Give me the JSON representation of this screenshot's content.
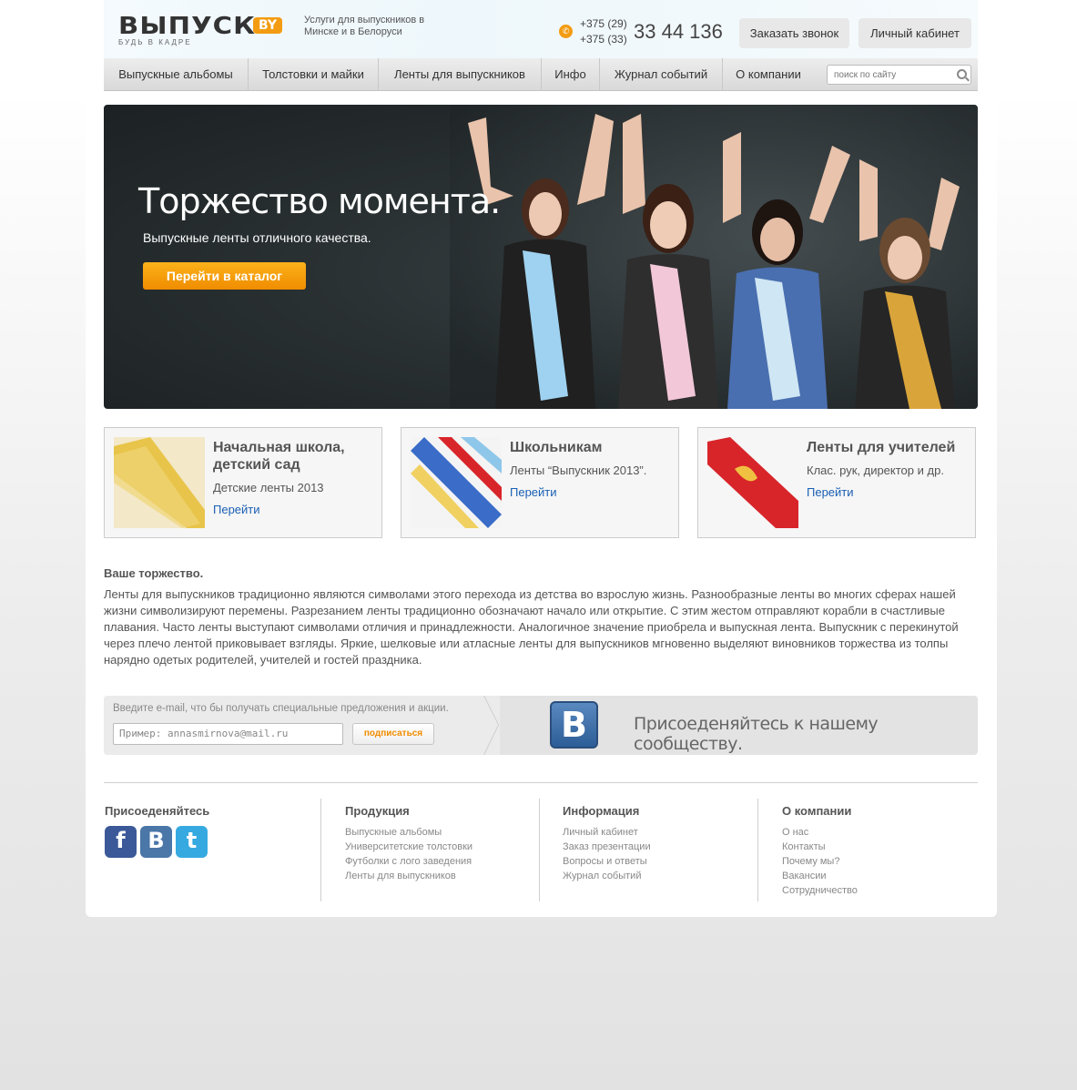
{
  "header": {
    "logo_word": "ВЫПУСК",
    "logo_suffix": "BY",
    "logo_tagline": "БУДЬ В КАДРЕ",
    "tagline": "Услуги для выпускников в Минске и в Белоруси",
    "phone_code_1": "+375 (29)",
    "phone_code_2": "+375 (33)",
    "phone_number": "33 44 136",
    "call_button": "Заказать звонок",
    "cabinet_button": "Личный кабинет"
  },
  "nav": {
    "items": [
      {
        "label": "Выпускные альбомы"
      },
      {
        "label": "Толстовки и майки"
      },
      {
        "label": "Ленты для выпускников"
      },
      {
        "label": "Инфо"
      },
      {
        "label": "Журнал событий"
      },
      {
        "label": "О компании"
      }
    ],
    "search_placeholder": "поиск по сайту"
  },
  "hero": {
    "title": "Торжество момента.",
    "subtitle": "Выпускные ленты отличного качества.",
    "cta": "Перейти в каталог"
  },
  "cards": [
    {
      "title": "Начальная школа, детский сад",
      "desc": "Детские ленты 2013",
      "link": "Перейти",
      "ribbon_color": "#e8c44a"
    },
    {
      "title": "Школьникам",
      "desc": "Ленты “Выпускник 2013”.",
      "link": "Перейти",
      "ribbon_color": "#3a6cc8"
    },
    {
      "title": "Ленты для учителей",
      "desc": "Клас. рук, директор и др.",
      "link": "Перейти",
      "ribbon_color": "#d8252a"
    }
  ],
  "article": {
    "title": "Ваше торжество.",
    "body": "Ленты для выпускников традиционно являются символами этого перехода из детства во взрослую жизнь. Разнообразные ленты во многих сферах нашей жизни символизируют перемены. Разрезанием ленты традиционно обозначают начало или открытие. С этим жестом отправляют корабли в счастливые плавания. Часто ленты выступают символами отличия и принадлежности. Аналогичное значение приобрела и выпускная лента. Выпускник с перекинутой через плечо лентой приковывает взгляды. Яркие, шелковые или атласные ленты для выпускников мгновенно выделяют виновников торжества из толпы нарядно одетых родителей, учителей и гостей праздника."
  },
  "subscribe": {
    "label": "Введите e-mail, что бы получать специальные предложения и акции.",
    "placeholder": "Пример: annasmirnova@mail.ru",
    "button": "подписаться",
    "vk_letter": "B",
    "join_text": "Присоеденяйтесь к нашему сообществу."
  },
  "footer": {
    "join_title": "Присоеденяйтесь",
    "columns": [
      {
        "title": "Продукция",
        "links": [
          "Выпускные альбомы",
          "Университетские толстовки",
          "Футболки с лого заведения",
          "Ленты для выпускников"
        ]
      },
      {
        "title": "Информация",
        "links": [
          "Личный кабинет",
          "Заказ презентации",
          "Вопросы и ответы",
          "Журнал событий"
        ]
      },
      {
        "title": "О компании",
        "links": [
          "О нас",
          "Контакты",
          "Почему мы?",
          "Вакансии",
          "Сотрудничество"
        ]
      }
    ],
    "social": [
      {
        "icon": "facebook-icon",
        "letter": "f",
        "color": "#3b5998"
      },
      {
        "icon": "vk-icon",
        "letter": "B",
        "color": "#4a76a8"
      },
      {
        "icon": "twitter-icon",
        "letter": "t",
        "color": "#36a9e1"
      }
    ]
  }
}
